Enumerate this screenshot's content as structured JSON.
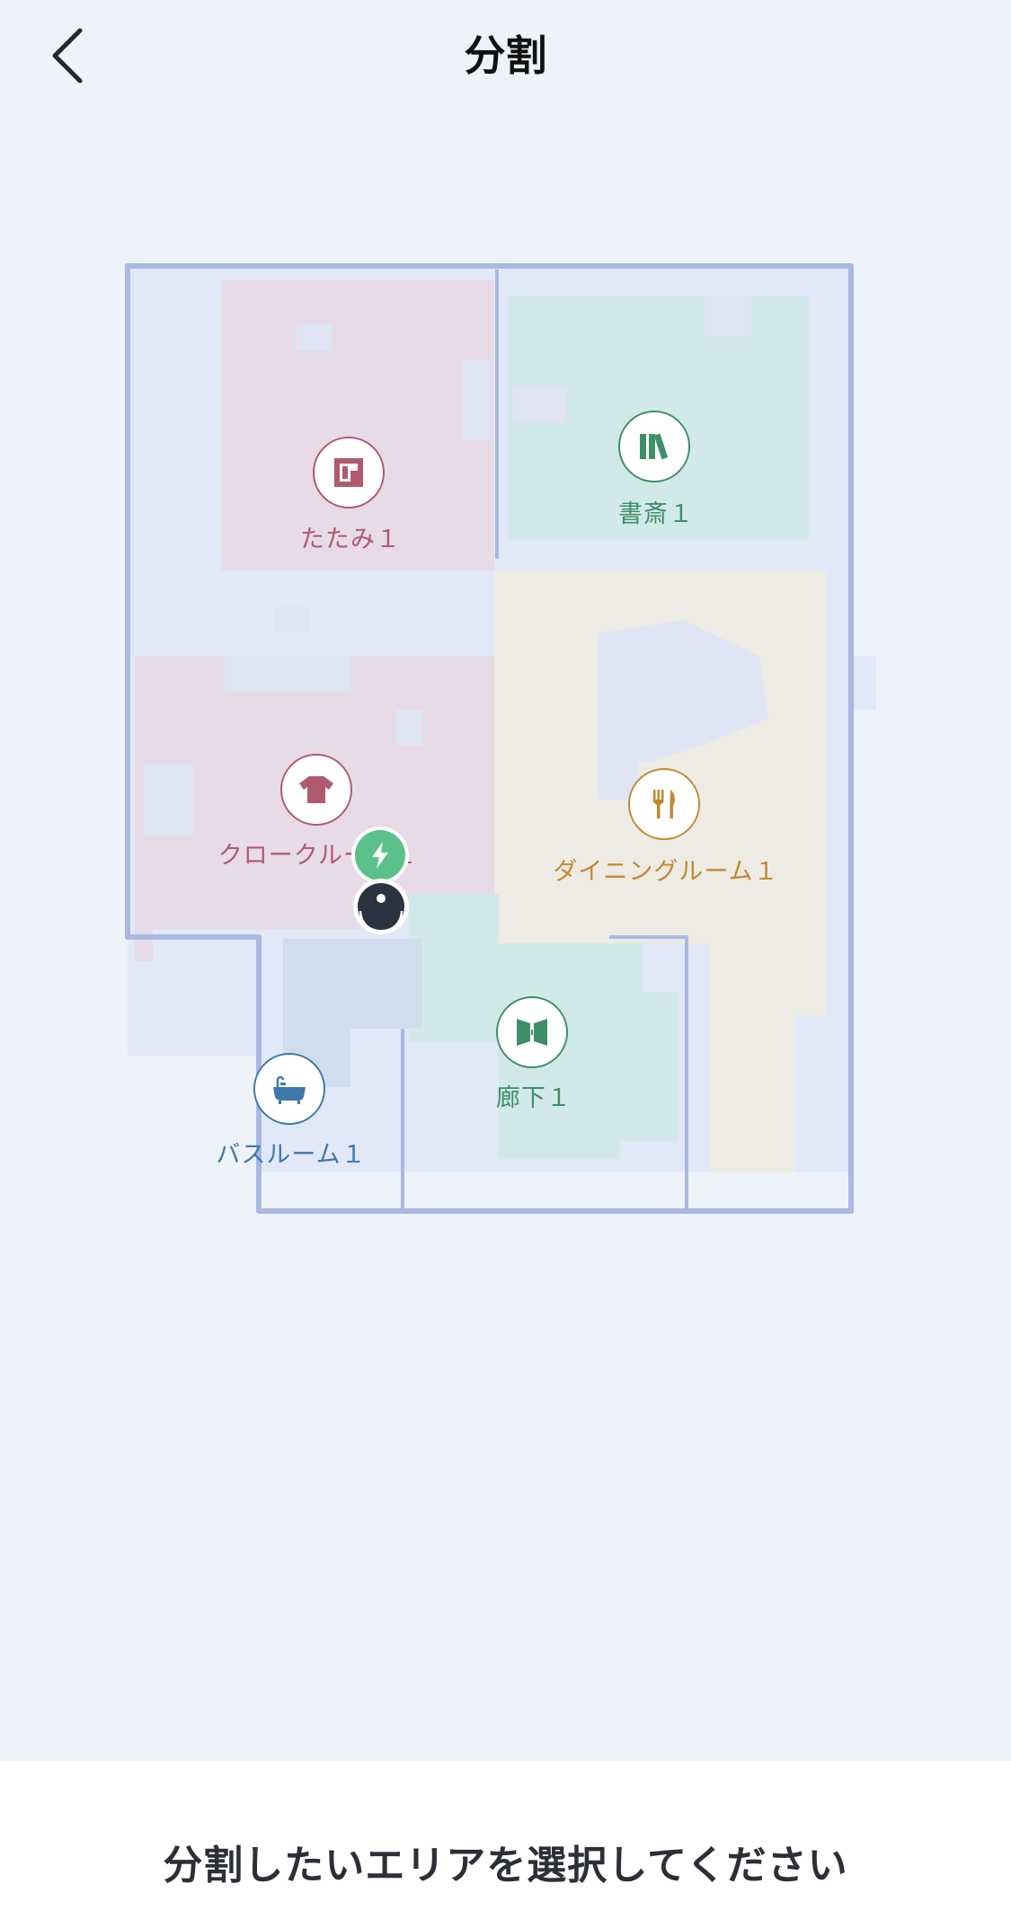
{
  "header": {
    "title": "分割",
    "back_icon": "chevron-left-icon"
  },
  "colors": {
    "background": "#eef2f9",
    "wall": "#a9b9e2",
    "tatami": "#e6dbe7",
    "closet": "#e6dbe7",
    "study": "#d2e9ea",
    "dining": "#eeebe4",
    "corridor": "#d2e9ea",
    "bathroom": "#d0ddef",
    "unassigned": "#e1e8f7",
    "tatami_accent": "#b05a70",
    "study_accent": "#3f8e68",
    "dining_accent": "#c08a30",
    "bathroom_accent": "#3f78ab",
    "dock": "#5cc08a",
    "robot": "#2a3340"
  },
  "rooms": {
    "tatami": {
      "label": "たたみ１",
      "icon": "tatami-mat-icon"
    },
    "study": {
      "label": "書斎１",
      "icon": "books-icon"
    },
    "closet": {
      "label": "クロークルーム１",
      "icon": "shirt-icon"
    },
    "dining": {
      "label": "ダイニングルーム１",
      "icon": "fork-knife-icon"
    },
    "corridor": {
      "label": "廊下１",
      "icon": "door-icon"
    },
    "bathroom": {
      "label": "バスルーム１",
      "icon": "bathtub-icon"
    }
  },
  "dock": {
    "icon": "charging-dock-icon"
  },
  "robot": {
    "icon": "robot-vacuum-icon"
  },
  "footer": {
    "instruction": "分割したいエリアを選択してください"
  }
}
